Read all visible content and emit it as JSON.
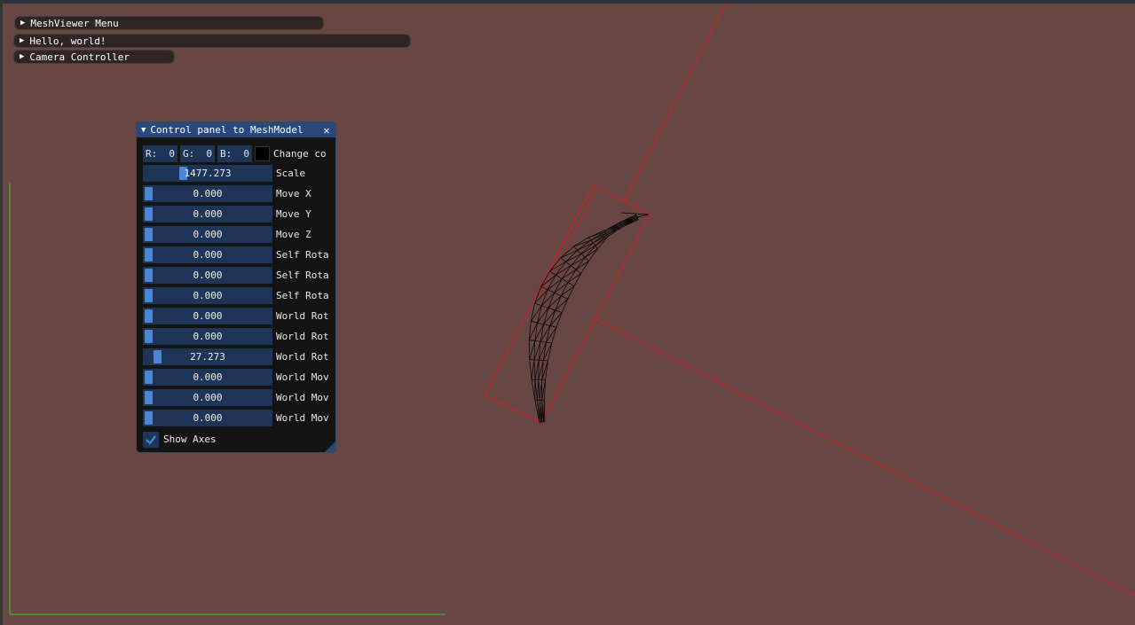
{
  "menus": [
    {
      "label": "MeshViewer Menu"
    },
    {
      "label": "Hello, world!"
    },
    {
      "label": "Camera Controller"
    }
  ],
  "panel": {
    "title": "Control panel to MeshModel",
    "color": {
      "r_label": "R:",
      "r_value": "0",
      "g_label": "G:",
      "g_value": "0",
      "b_label": "B:",
      "b_value": "0",
      "change_label": "Change co",
      "swatch": "#000000"
    },
    "sliders": [
      {
        "value": "1477.273",
        "label": "Scale",
        "fraction": 0.29
      },
      {
        "value": "0.000",
        "label": "Move X",
        "fraction": 0.0
      },
      {
        "value": "0.000",
        "label": "Move Y",
        "fraction": 0.0
      },
      {
        "value": "0.000",
        "label": "Move Z",
        "fraction": 0.0
      },
      {
        "value": "0.000",
        "label": "Self Rota",
        "fraction": 0.0
      },
      {
        "value": "0.000",
        "label": "Self Rota",
        "fraction": 0.0
      },
      {
        "value": "0.000",
        "label": "Self Rota",
        "fraction": 0.0
      },
      {
        "value": "0.000",
        "label": "World Rot",
        "fraction": 0.0
      },
      {
        "value": "0.000",
        "label": "World Rot",
        "fraction": 0.0
      },
      {
        "value": "27.273",
        "label": "World Rot",
        "fraction": 0.076
      },
      {
        "value": "0.000",
        "label": "World Mov",
        "fraction": 0.0
      },
      {
        "value": "0.000",
        "label": "World Mov",
        "fraction": 0.0
      },
      {
        "value": "0.000",
        "label": "World Mov",
        "fraction": 0.0
      }
    ],
    "show_axes_label": "Show Axes",
    "show_axes_checked": true
  },
  "colors": {
    "background": "#684644",
    "axis_red": "#d81e1e",
    "axis_green": "#2ecc2e",
    "mesh": "#000000",
    "accent": "#4a86d6"
  }
}
